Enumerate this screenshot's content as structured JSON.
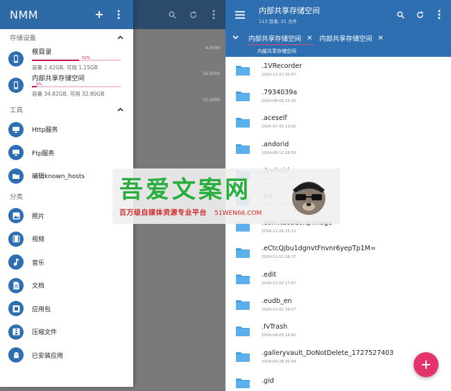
{
  "drawer": {
    "app_title": "NMM",
    "sections": {
      "storage": "存储设备",
      "tools": "工具",
      "categories": "分类"
    },
    "storage_items": [
      {
        "name": "根目录",
        "percent_label": "52%",
        "percent": 52,
        "capacity": "容量 2.42GB, 可用 1.15GB"
      },
      {
        "name": "内部共享存储空间",
        "percent_label": "5%",
        "percent": 5,
        "capacity": "容量 34.82GB, 可用 32.80GB"
      }
    ],
    "tools": [
      "Http服务",
      "Ftp服务",
      "编辑known_hosts"
    ],
    "categories": [
      "照片",
      "视频",
      "音乐",
      "文档",
      "应用包",
      "压缩文件",
      "已安装应用"
    ]
  },
  "behind_sizes": [
    "4.0000",
    "32.0000",
    "32.2000"
  ],
  "browser": {
    "title": "内部共享存储空间",
    "subtitle": "113 目录, 31 文件",
    "tabs": [
      "内部共享存储空间",
      "内部共享存储空间"
    ],
    "path": "内部共享存储空间",
    "files": [
      {
        "name": ".1VRecorder",
        "date": "2024-11-27 20:07"
      },
      {
        "name": ".7934039a",
        "date": "2024-08-06 15:16"
      },
      {
        "name": ".aceself",
        "date": "2024-07-31 13:00"
      },
      {
        "name": ".andorid",
        "date": "2024-08-12 18:55"
      },
      {
        "name": ".Android",
        "date": "2024-12-19 18:17"
      },
      {
        "name": ".bd",
        "date": "2024-12-25 10:29"
      },
      {
        "name": ".com.taobao.tpimage",
        "date": "2024-12-24 15:12"
      },
      {
        "name": ".eCtcQjbu1dgnvtFnvnr6yepTp1M=",
        "date": "2024-12-11 16:37"
      },
      {
        "name": ".edit",
        "date": "2024-12-02 17:47"
      },
      {
        "name": ".eudb_en",
        "date": "2024-11-01 16:17"
      },
      {
        "name": ".fvTrash",
        "date": "2024-08-05 18:41"
      },
      {
        "name": ".galleryvault_DoNotDelete_1727527403",
        "date": "2024-09-28 20:44"
      },
      {
        "name": ".gid",
        "date": ""
      }
    ]
  },
  "watermark": {
    "title": "吾爱文案网",
    "tagline": "百万级自媒体资源专业平台",
    "url": "51WEN66.COM"
  },
  "colors": {
    "primary": "#2e6fb2",
    "drawer_header": "#2f6aa8",
    "accent": "#e3356b",
    "progress": "#c2185b"
  }
}
